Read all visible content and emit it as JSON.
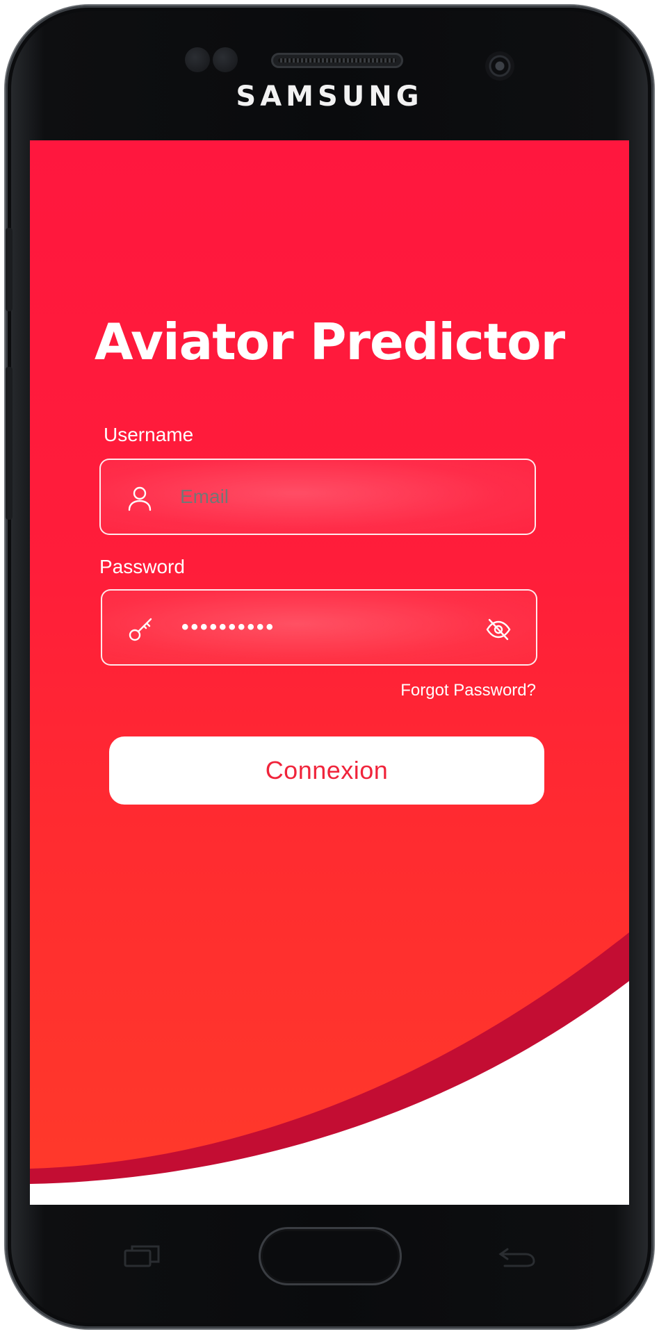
{
  "device": {
    "brand": "SAMSUNG"
  },
  "app": {
    "title": "Aviator Predictor"
  },
  "login": {
    "username_label": "Username",
    "username_placeholder": "Email",
    "password_label": "Password",
    "password_value": "••••••••••",
    "forgot_link": "Forgot Password?",
    "submit_label": "Connexion"
  },
  "icons": {
    "username": "user-icon",
    "password": "key-icon",
    "visibility": "eye-off-icon",
    "nav_recent": "recent-apps-icon",
    "nav_back": "back-icon"
  },
  "colors": {
    "background_red": "#ff1d3a",
    "wave_dark": "#c30d33",
    "button_text": "#f0243b"
  }
}
